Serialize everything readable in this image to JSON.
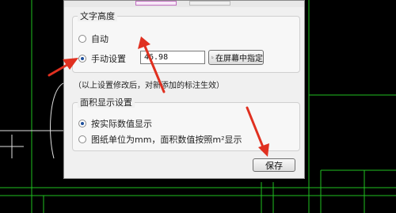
{
  "text_height_group": {
    "title": "文字高度",
    "auto_label": "自动",
    "manual_label": "手动设置",
    "manual_value": "46.98",
    "pick_button_label": "在屏幕中指定"
  },
  "note": "（以上设置修改后，对新添加的标注生效）",
  "area_group": {
    "title": "面积显示设置",
    "option_actual": "按实际数值显示",
    "option_mm": "图纸单位为mm，面积数值按照m²显示"
  },
  "save_button_label": "保存",
  "colors": {
    "annotation_arrow": "#e03020",
    "cad_green": "#20c020",
    "cad_white": "#e0e0e0"
  }
}
